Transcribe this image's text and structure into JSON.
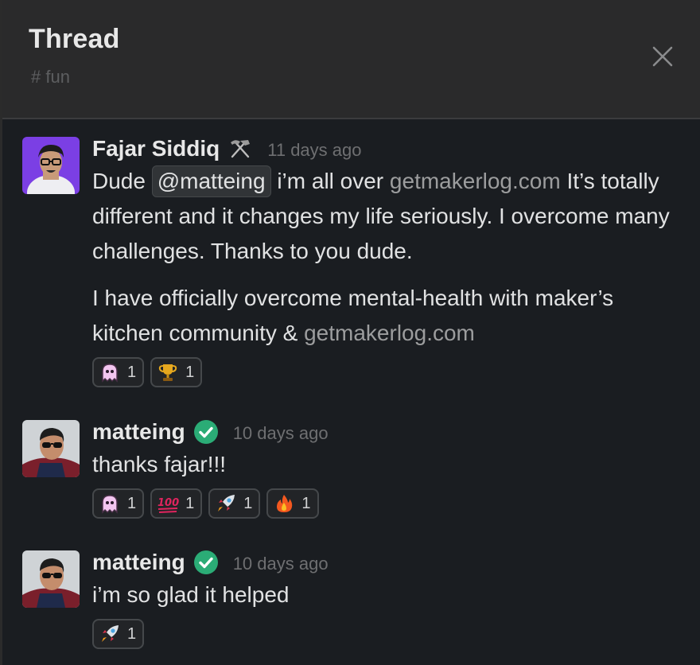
{
  "header": {
    "title": "Thread",
    "channel": "# fun"
  },
  "messages": [
    {
      "author": "Fajar Siddiq",
      "status_icon": "hammer-pick-icon",
      "timestamp": "11 days ago",
      "body": {
        "p1_before_mention": "Dude ",
        "mention": "@matteing",
        "p1_after_mention": " i’m all over ",
        "link1": "getmakerlog.com",
        "p1_rest": " It’s totally different and it changes my life seriously. I overcome many challenges. Thanks to you dude.",
        "p2_text": "I have officially overcome mental-health with maker’s kitchen community & ",
        "link2": "getmakerlog.com"
      },
      "reactions": [
        {
          "emoji": "ghost-icon",
          "count": "1"
        },
        {
          "emoji": "trophy-icon",
          "count": "1"
        }
      ]
    },
    {
      "author": "matteing",
      "status_icon": "verified-check-icon",
      "timestamp": "10 days ago",
      "body": {
        "text": "thanks fajar!!!"
      },
      "reactions": [
        {
          "emoji": "ghost-icon",
          "count": "1"
        },
        {
          "emoji": "hundred-points-icon",
          "count": "1"
        },
        {
          "emoji": "rocket-icon",
          "count": "1"
        },
        {
          "emoji": "fire-icon",
          "count": "1"
        }
      ]
    },
    {
      "author": "matteing",
      "status_icon": "verified-check-icon",
      "timestamp": "10 days ago",
      "body": {
        "text": "i’m so glad it helped"
      },
      "reactions": [
        {
          "emoji": "rocket-icon",
          "count": "1"
        }
      ]
    }
  ],
  "colors": {
    "background": "#1a1d21",
    "header_background": "#2a2a2b",
    "verified_green": "#2bac76",
    "link_gray": "#9c9d9e",
    "avatar_purple": "#7b3fe4"
  }
}
